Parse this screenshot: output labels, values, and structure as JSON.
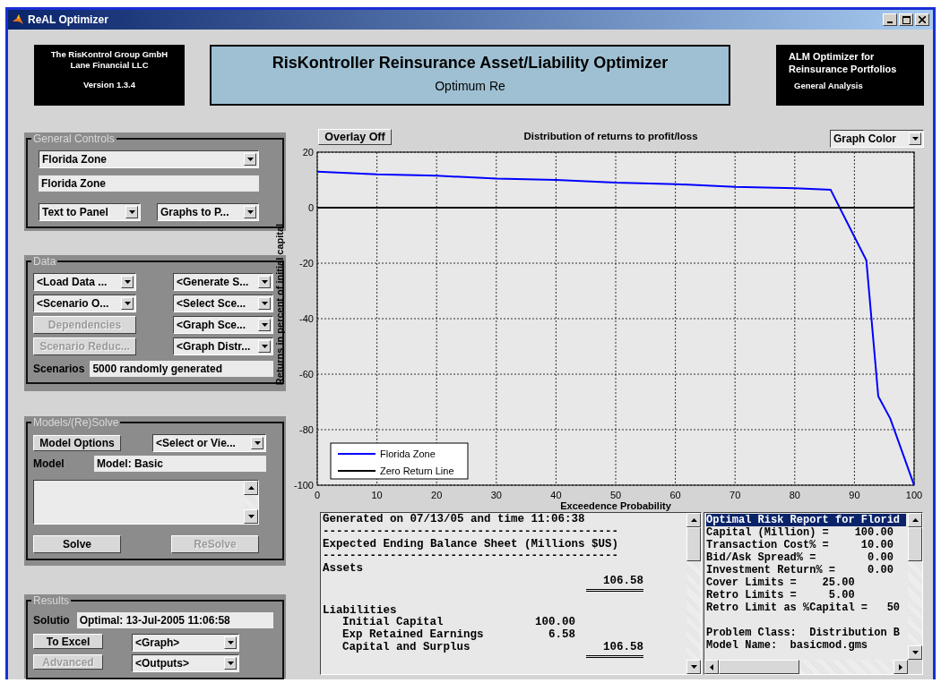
{
  "window": {
    "title": "ReAL Optimizer"
  },
  "header": {
    "left_lines": [
      "The RisKontrol Group GmbH",
      "Lane Financial LLC",
      "Version 1.3.4"
    ],
    "title": "RisKontroller Reinsurance Asset/Liability Optimizer",
    "subtitle": "Optimum Re",
    "right_lines": [
      "ALM Optimizer for",
      "Reinsurance Portfolios",
      "General Analysis"
    ]
  },
  "general_controls": {
    "label": "General Controls",
    "zone_dropdown": "Florida Zone",
    "zone_text": "Florida Zone",
    "output_dropdowns": [
      "Text to Panel",
      "Graphs to P..."
    ]
  },
  "data": {
    "label": "Data",
    "left_controls": [
      {
        "kind": "dropdown",
        "label": "<Load Data ...",
        "disabled": false
      },
      {
        "kind": "dropdown",
        "label": "<Scenario O...",
        "disabled": false
      },
      {
        "kind": "button",
        "label": "Dependencies",
        "disabled": true
      },
      {
        "kind": "button",
        "label": "Scenario Reduc...",
        "disabled": true
      }
    ],
    "right_controls": [
      {
        "kind": "dropdown",
        "label": "<Generate S...",
        "disabled": false
      },
      {
        "kind": "dropdown",
        "label": "<Select Sce...",
        "disabled": false
      },
      {
        "kind": "dropdown",
        "label": "<Graph Sce...",
        "disabled": false
      },
      {
        "kind": "dropdown",
        "label": "<Graph Distr...",
        "disabled": false
      }
    ],
    "scenarios_label": "Scenarios",
    "scenarios_value": "5000 randomly generated"
  },
  "models": {
    "label": "Models/(Re)Solve",
    "options_button": "Model Options",
    "select_dropdown": "<Select or Vie...",
    "model_label": "Model",
    "model_value": "Model: Basic",
    "buttons": [
      {
        "label": "Solve",
        "disabled": false
      },
      {
        "label": "ReSolve",
        "disabled": true
      }
    ]
  },
  "results": {
    "label": "Results",
    "status_label": "Solutio",
    "status_value": "Optimal: 13-Jul-2005 11:06:58",
    "buttons": [
      {
        "label": "To Excel",
        "disabled": false
      },
      {
        "label": "Advanced",
        "disabled": true
      }
    ],
    "dropdowns": [
      "<Graph>",
      "<Outputs>"
    ]
  },
  "chart": {
    "overlay_button": "Overlay Off",
    "graph_color_dropdown": "Graph Color",
    "chart_data": {
      "type": "line",
      "title": "Distribution of returns to profit/loss",
      "xlabel": "Exceedence Probability",
      "ylabel": "Returns in percent of initial capital",
      "x": [
        0,
        10,
        20,
        30,
        40,
        50,
        60,
        70,
        80,
        86,
        92,
        94,
        96,
        100
      ],
      "series": [
        {
          "name": "Florida Zone",
          "color": "#0000ff",
          "values": [
            13,
            12,
            11.5,
            10.5,
            10,
            9,
            8.5,
            7.5,
            7,
            6.5,
            -19,
            -68,
            -76,
            -100
          ]
        },
        {
          "name": "Zero Return Line",
          "color": "#000000",
          "values": [
            0,
            0,
            0,
            0,
            0,
            0,
            0,
            0,
            0,
            0,
            0,
            0,
            0,
            0
          ]
        }
      ],
      "legend": "lower left",
      "xlim": [
        0,
        100
      ],
      "ylim": [
        -100,
        20
      ],
      "xticks": [
        0,
        10,
        20,
        30,
        40,
        50,
        60,
        70,
        80,
        90,
        100
      ],
      "yticks": [
        20,
        0,
        -20,
        -40,
        -60,
        -80,
        -100
      ]
    }
  },
  "report_panel": {
    "lines": [
      {
        "kind": "text",
        "text": "Generated on 07/13/05 and time 11:06:38"
      },
      {
        "kind": "text",
        "text": "--------------------------------------------"
      },
      {
        "kind": "text",
        "text": "Expected Ending Balance Sheet (Millions $US)"
      },
      {
        "kind": "text",
        "text": "--------------------------------------------"
      },
      {
        "kind": "text",
        "text": "Assets"
      },
      {
        "kind": "entry",
        "total": "106.58"
      },
      {
        "kind": "double_rule"
      },
      {
        "kind": "blank"
      },
      {
        "kind": "text",
        "text": "Liabilities"
      },
      {
        "kind": "entry",
        "label": "Initial Capital",
        "amount": "100.00"
      },
      {
        "kind": "entry",
        "label": "Exp Retained Earnings",
        "amount": "6.58"
      },
      {
        "kind": "entry",
        "label": "Capital and Surplus",
        "total": "106.58"
      },
      {
        "kind": "double_rule"
      }
    ]
  },
  "risk_panel": {
    "lines": [
      {
        "text": "Optimal Risk Report for Florid",
        "selected": true,
        "gap_before": false
      },
      {
        "text": "Capital (Million) =    100.00",
        "selected": false,
        "gap_before": false
      },
      {
        "text": "Transaction Cost% =     10.00",
        "selected": false,
        "gap_before": false
      },
      {
        "text": "Bid/Ask Spread% =        0.00",
        "selected": false,
        "gap_before": false
      },
      {
        "text": "Investment Return% =     0.00",
        "selected": false,
        "gap_before": false
      },
      {
        "text": "Cover Limits =    25.00",
        "selected": false,
        "gap_before": false
      },
      {
        "text": "Retro Limits =     5.00",
        "selected": false,
        "gap_before": false
      },
      {
        "text": "Retro Limit as %Capital =   50",
        "selected": false,
        "gap_before": false
      },
      {
        "text": "Problem Class:  Distribution B",
        "selected": false,
        "gap_before": true
      },
      {
        "text": "Model Name:  basicmod.gms",
        "selected": false,
        "gap_before": false
      }
    ]
  }
}
